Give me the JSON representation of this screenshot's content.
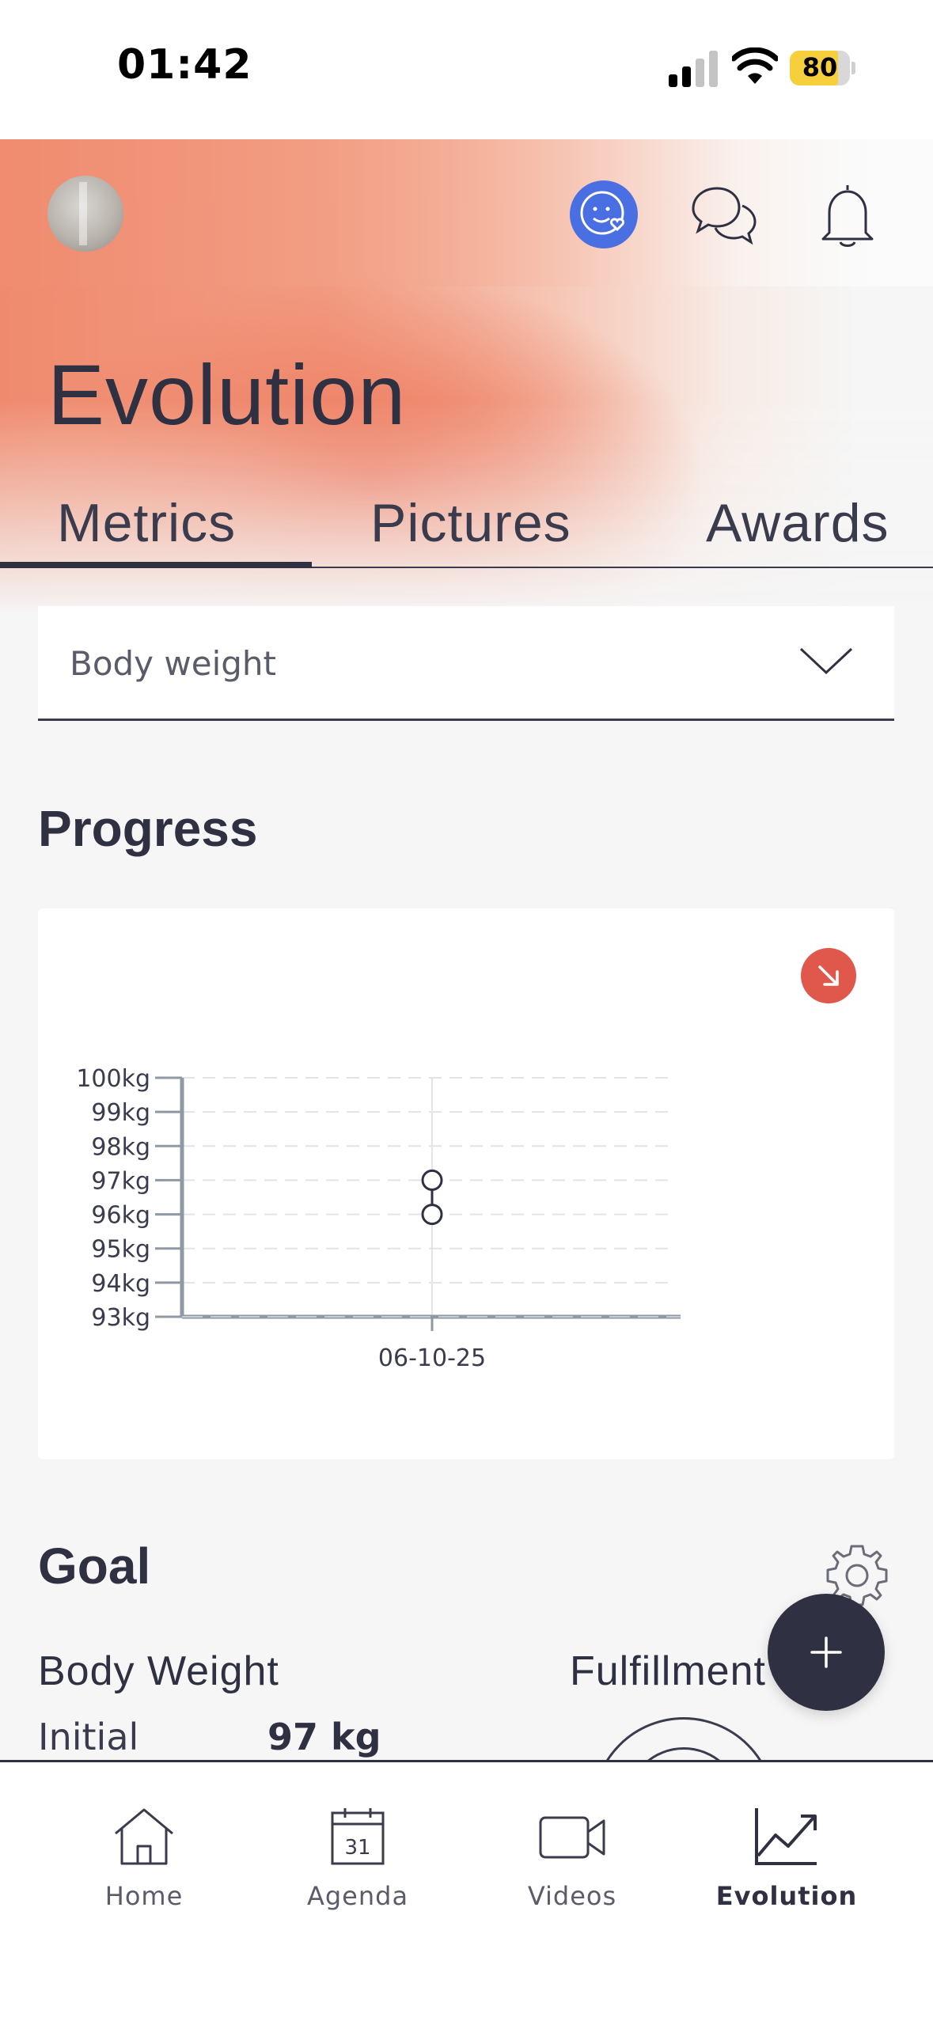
{
  "status_bar": {
    "time": "01:42",
    "battery": "80",
    "battery_level": 0.8
  },
  "header": {
    "title": "Evolution"
  },
  "tabs": [
    {
      "label": "Metrics",
      "active": true
    },
    {
      "label": "Pictures",
      "active": false
    },
    {
      "label": "Awards",
      "active": false
    }
  ],
  "metric_select": {
    "value": "Body weight"
  },
  "progress": {
    "title": "Progress"
  },
  "chart_data": {
    "type": "line",
    "y_tick_labels": [
      "100kg",
      "99kg",
      "98kg",
      "97kg",
      "96kg",
      "95kg",
      "94kg",
      "93kg"
    ],
    "ylim": [
      93,
      100
    ],
    "x_tick_labels": [
      "06-10-25"
    ],
    "series": [
      {
        "points": [
          {
            "x": "06-10-25",
            "y": 97
          },
          {
            "x": "06-10-25",
            "y": 96
          }
        ]
      }
    ],
    "grid": true
  },
  "goal": {
    "title": "Goal",
    "metric": "Body Weight",
    "fulfillment_label": "Fulfillment",
    "initial_label": "Initial",
    "initial_value": "97 kg"
  },
  "nav": [
    {
      "label": "Home",
      "icon": "home-icon",
      "active": false
    },
    {
      "label": "Agenda",
      "icon": "calendar-icon",
      "active": false,
      "day": "31"
    },
    {
      "label": "Videos",
      "icon": "video-icon",
      "active": false
    },
    {
      "label": "Evolution",
      "icon": "trend-chart-icon",
      "active": true
    }
  ]
}
